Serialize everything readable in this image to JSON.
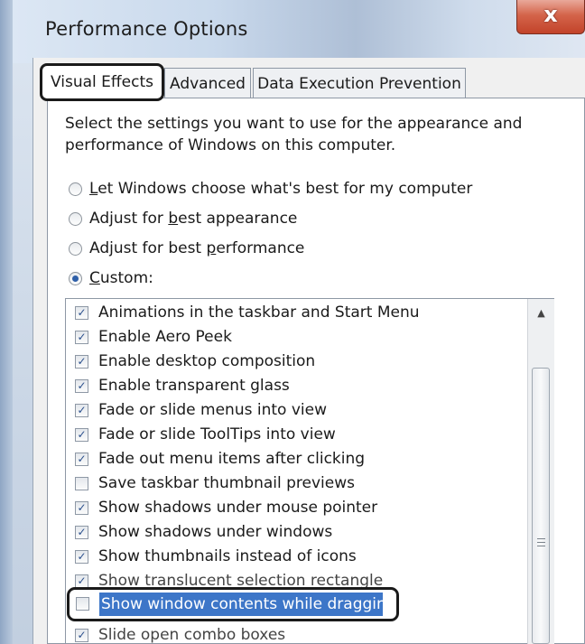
{
  "window": {
    "title": "Performance Options",
    "close_glyph": "x"
  },
  "tabs": [
    {
      "label": "Visual Effects",
      "selected": true
    },
    {
      "label": "Advanced",
      "selected": false
    },
    {
      "label": "Data Execution Prevention",
      "selected": false
    }
  ],
  "visual_effects": {
    "description": "Select the settings you want to use for the appearance and performance of Windows on this computer.",
    "options": [
      {
        "before": "",
        "accel": "L",
        "after": "et Windows choose what's best for my computer",
        "checked": false
      },
      {
        "before": "Adjust for ",
        "accel": "b",
        "after": "est appearance",
        "checked": false
      },
      {
        "before": "Adjust for best ",
        "accel": "p",
        "after": "erformance",
        "checked": false
      },
      {
        "before": "",
        "accel": "C",
        "after": "ustom:",
        "checked": true
      }
    ],
    "items": [
      {
        "label": "Animations in the taskbar and Start Menu",
        "checked": true
      },
      {
        "label": "Enable Aero Peek",
        "checked": true
      },
      {
        "label": "Enable desktop composition",
        "checked": true
      },
      {
        "label": "Enable transparent glass",
        "checked": true
      },
      {
        "label": "Fade or slide menus into view",
        "checked": true
      },
      {
        "label": "Fade or slide ToolTips into view",
        "checked": true
      },
      {
        "label": "Fade out menu items after clicking",
        "checked": true
      },
      {
        "label": "Save taskbar thumbnail previews",
        "checked": false
      },
      {
        "label": "Show shadows under mouse pointer",
        "checked": true
      },
      {
        "label": "Show shadows under windows",
        "checked": true
      },
      {
        "label": "Show thumbnails instead of icons",
        "checked": true
      },
      {
        "label": "Show translucent selection rectangle",
        "checked": true
      },
      {
        "label": "Show window contents while dragging",
        "checked": false,
        "selected": true
      },
      {
        "label": "Slide open combo boxes",
        "checked": true
      }
    ],
    "check_glyph": "✓"
  },
  "scrollbar": {
    "up_glyph": "▲"
  },
  "colors": {
    "selection": "#3d76c8",
    "close": "#c2432a"
  }
}
